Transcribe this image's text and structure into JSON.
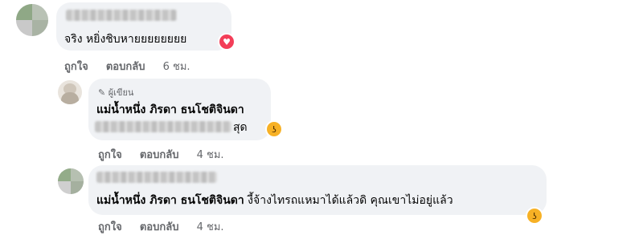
{
  "comments": [
    {
      "text": "จริง หยิ่งชิบหายยยยยยยย",
      "actions": {
        "like": "ถูกใจ",
        "reply": "ตอบกลับ",
        "time": "6 ชม."
      },
      "reaction": "heart-icon"
    },
    {
      "author_badge": "ผู้เขียน",
      "name": "แม่น้ำหนึ่ง ภิรดา ธนโชติจินดา",
      "text_tail": "สุด",
      "actions": {
        "like": "ถูกใจ",
        "reply": "ตอบกลับ",
        "time": "4 ชม."
      },
      "reaction": "haha-icon"
    },
    {
      "mention": "แม่น้ำหนึ่ง ภิรดา ธนโชติจินดา",
      "text": " งี้จ้างไทรถแหมาได้แล้วดิ คุณเขาไม่อยู่แล้ว",
      "actions": {
        "like": "ถูกใจ",
        "reply": "ตอบกลับ",
        "time": "4 ชม."
      },
      "reaction": "haha-icon"
    }
  ],
  "colors": {
    "bubble": "#f0f2f5",
    "secondary_text": "#65676b",
    "heart": "#f33e58",
    "haha": "#f7b125"
  }
}
